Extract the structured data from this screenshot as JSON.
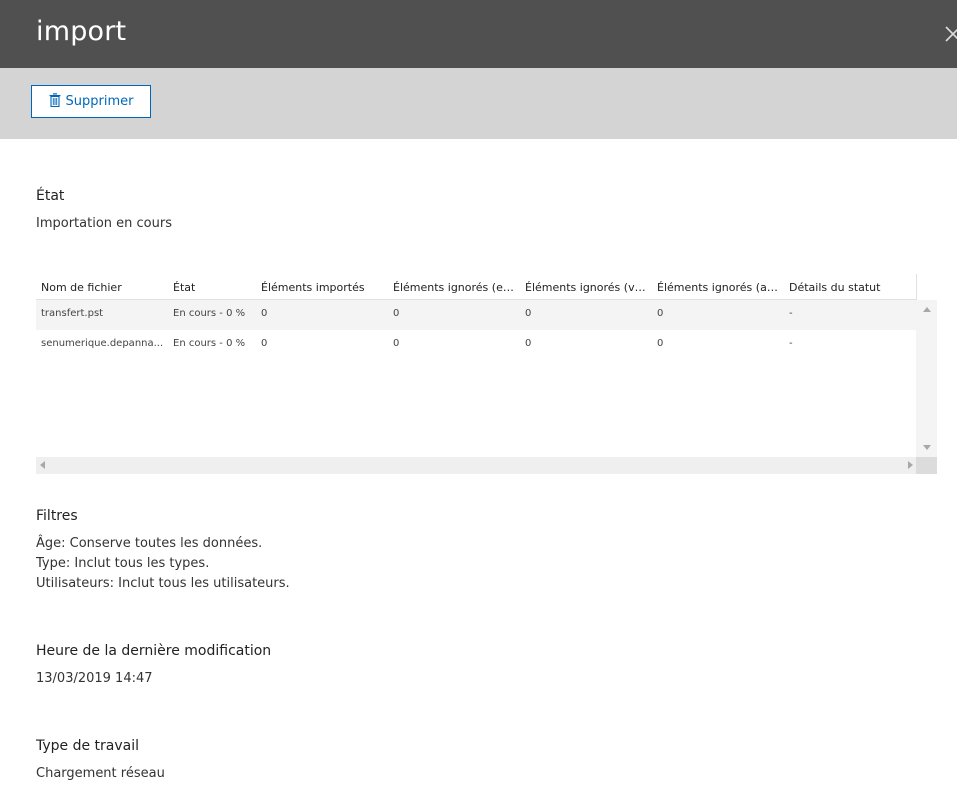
{
  "header": {
    "title": "import",
    "close_icon": "close-icon"
  },
  "toolbar": {
    "delete_label": "Supprimer",
    "delete_icon": "trash-icon",
    "accent": "#0067b8"
  },
  "status": {
    "label": "État",
    "value": "Importation en cours"
  },
  "table": {
    "columns": [
      "Nom de fichier",
      "État",
      "Éléments importés",
      "Éléments ignorés (end...",
      "Éléments ignorés (volu...",
      "Éléments ignorés (autr...",
      "Détails du statut"
    ],
    "rows": [
      [
        "transfert.pst",
        "En cours - 0 %",
        "0",
        "0",
        "0",
        "0",
        "-"
      ],
      [
        "senumerique.depanna...",
        "En cours - 0 %",
        "0",
        "0",
        "0",
        "0",
        "-"
      ]
    ]
  },
  "filters": {
    "label": "Filtres",
    "lines": [
      "Âge: Conserve toutes les données.",
      "Type: Inclut tous les types.",
      "Utilisateurs: Inclut tous les utilisateurs."
    ]
  },
  "last_modified": {
    "label": "Heure de la dernière modification",
    "value": "13/03/2019 14:47"
  },
  "job_type": {
    "label": "Type de travail",
    "value": "Chargement réseau"
  }
}
